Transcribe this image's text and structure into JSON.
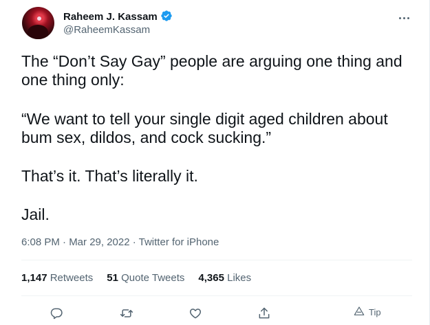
{
  "author": {
    "name": "Raheem J. Kassam",
    "handle": "@RaheemKassam",
    "verified": true
  },
  "tweet": {
    "paragraphs": [
      "The “Don’t Say Gay” people are arguing one thing and one thing only:",
      "“We want to tell your single digit aged children about bum sex, dildos, and cock sucking.”",
      "That’s it. That’s literally it.",
      "Jail."
    ],
    "timestamp": "6:08 PM · Mar 29, 2022 · Twitter for iPhone"
  },
  "stats": {
    "retweets_count": "1,147",
    "retweets_label": "Retweets",
    "quotes_count": "51",
    "quotes_label": "Quote Tweets",
    "likes_count": "4,365",
    "likes_label": "Likes"
  },
  "actions": {
    "tip_label": "Tip"
  },
  "colors": {
    "verified_blue": "#1d9bf0",
    "secondary_text": "#536471"
  }
}
